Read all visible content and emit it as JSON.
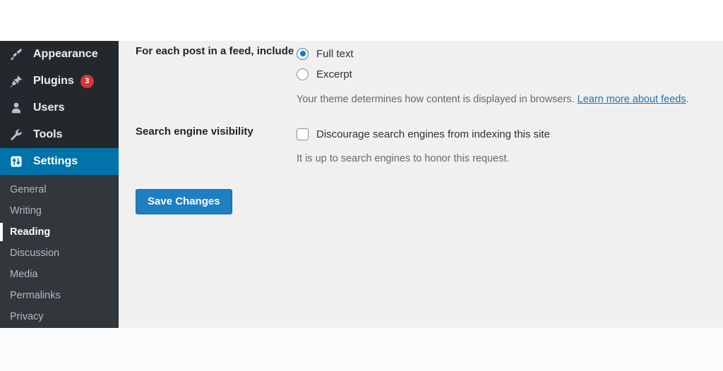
{
  "sidebar": {
    "items": [
      {
        "label": "Appearance",
        "icon": "paintbrush-icon",
        "current": false,
        "badge": null
      },
      {
        "label": "Plugins",
        "icon": "plug-icon",
        "current": false,
        "badge": "3"
      },
      {
        "label": "Users",
        "icon": "user-icon",
        "current": false,
        "badge": null
      },
      {
        "label": "Tools",
        "icon": "wrench-icon",
        "current": false,
        "badge": null
      },
      {
        "label": "Settings",
        "icon": "settings-sliders-icon",
        "current": true,
        "badge": null
      }
    ],
    "submenu": [
      {
        "label": "General",
        "current": false
      },
      {
        "label": "Writing",
        "current": false
      },
      {
        "label": "Reading",
        "current": true
      },
      {
        "label": "Discussion",
        "current": false
      },
      {
        "label": "Media",
        "current": false
      },
      {
        "label": "Permalinks",
        "current": false
      },
      {
        "label": "Privacy",
        "current": false
      }
    ]
  },
  "feed_row": {
    "label": "For each post in a feed, include",
    "options": [
      {
        "label": "Full text",
        "selected": true
      },
      {
        "label": "Excerpt",
        "selected": false
      }
    ],
    "help_prefix": "Your theme determines how content is displayed in browsers. ",
    "help_link": "Learn more about feeds",
    "help_suffix": "."
  },
  "search_row": {
    "label": "Search engine visibility",
    "checkbox_label": "Discourage search engines from indexing this site",
    "checked": false,
    "help_text": "It is up to search engines to honor this request."
  },
  "actions": {
    "save_label": "Save Changes"
  },
  "colors": {
    "sidebar_bg": "#23282d",
    "submenu_bg": "#32373c",
    "accent": "#0073aa",
    "button": "#1e7fc1",
    "badge": "#d63638",
    "link": "#2271b1",
    "content_bg": "#f0f0f0"
  }
}
